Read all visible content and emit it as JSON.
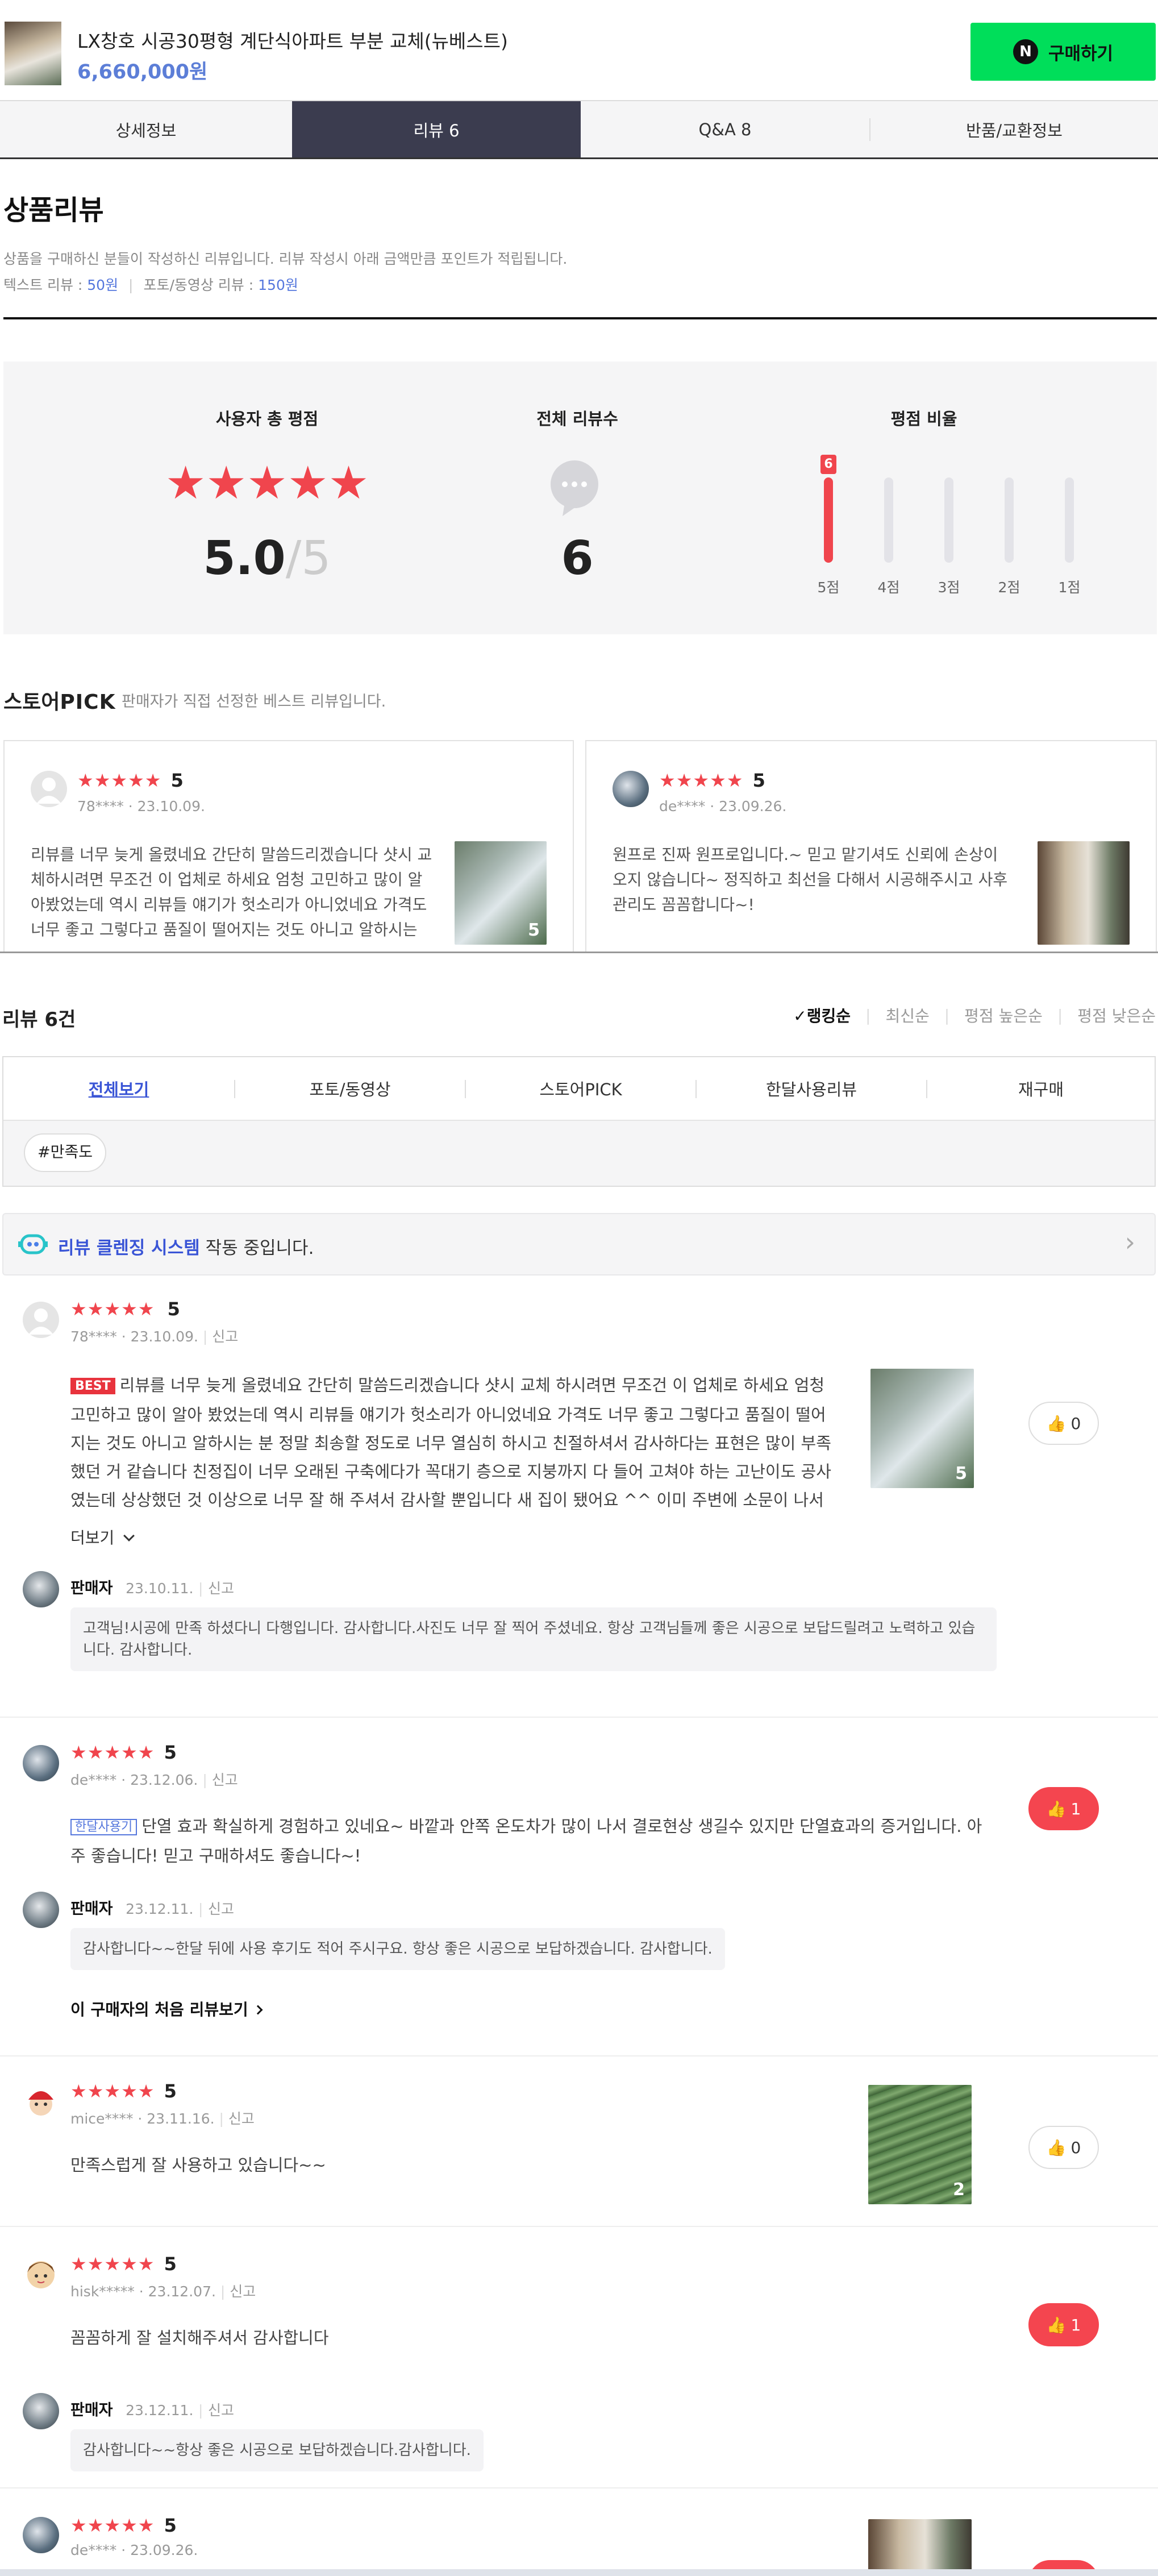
{
  "product": {
    "title": "LX창호 시공30평형 계단식아파트 부분 교체(뉴베스트)",
    "price": "6,660,000원"
  },
  "buy_button": {
    "badge": "N",
    "label": "구매하기"
  },
  "tabs": [
    {
      "label": "상세정보"
    },
    {
      "label": "리뷰 6"
    },
    {
      "label": "Q&A 8"
    },
    {
      "label": "반품/교환정보"
    }
  ],
  "section": {
    "title": "상품리뷰",
    "desc": "상품을 구매하신 분들이 작성하신 리뷰입니다. 리뷰 작성시 아래 금액만큼 포인트가 적립됩니다.",
    "text_review_label": "텍스트 리뷰 :",
    "text_review_points": "50원",
    "photo_review_label": "포토/동영상 리뷰 :",
    "photo_review_points": "150원"
  },
  "summary": {
    "score_title": "사용자 총 평점",
    "stars": "★★★★★",
    "score": "5.0",
    "score_max": "/5",
    "count_title": "전체 리뷰수",
    "count": "6",
    "ratio_title": "평점 비율",
    "bars": [
      {
        "label": "5점",
        "ratio": 1.0,
        "badge": "6"
      },
      {
        "label": "4점",
        "ratio": 0
      },
      {
        "label": "3점",
        "ratio": 0
      },
      {
        "label": "2점",
        "ratio": 0
      },
      {
        "label": "1점",
        "ratio": 0
      }
    ]
  },
  "store_pick": {
    "title_a": "스토어",
    "title_b": "PICK",
    "desc": "판매자가 직접 선정한 베스트 리뷰입니다.",
    "cards": [
      {
        "stars": "★★★★★",
        "score": "5",
        "user": "78****",
        "date": "23.10.09.",
        "text": "리뷰를 너무 늦게 올렸네요 간단히 말씀드리겠습니다 샷시 교체하시려면 무조건 이 업체로 하세요 엄청 고민하고 많이 알아봤었는데 역시 리뷰들 얘기가 헛소리가 아니었네요 가격도 너무 좋고 그렇다고 품질이 떨어지는 것도 아니고 알하시는 분 정말...",
        "photo_count": "5"
      },
      {
        "stars": "★★★★★",
        "score": "5",
        "user": "de****",
        "date": "23.09.26.",
        "text": "원프로 진짜 원프로입니다.~ 믿고 맡기셔도 신뢰에 손상이 오지 않습니다~ 정직하고 최선을 다해서 시공해주시고 사후 관리도 꼼꼼합니다~!",
        "photo_count": ""
      }
    ]
  },
  "review_list": {
    "count_label": "리뷰 6건",
    "sorts": [
      "랭킹순",
      "최신순",
      "평점 높은순",
      "평점 낮은순"
    ],
    "check": "✓",
    "filters": [
      "전체보기",
      "포토/동영상",
      "스토어PICK",
      "한달사용리뷰",
      "재구매"
    ],
    "tag": "#만족도",
    "clean_highlight": "리뷰 클렌징 시스템",
    "clean_rest": " 작동 중입니다.",
    "chevron": "›"
  },
  "reviews": [
    {
      "stars": "★★★★★",
      "score": "5",
      "user": "78****",
      "date": "23.10.09.",
      "report": "신고",
      "badge": "BEST",
      "text": "리뷰를 너무 늦게 올렸네요 간단히 말씀드리겠습니다 샷시 교체 하시려면 무조건 이 업체로 하세요 엄청 고민하고 많이 알아 봤었는데 역시 리뷰들 얘기가 헛소리가 아니었네요 가격도 너무 좋고 그렇다고 품질이 떨어지는 것도 아니고 알하시는 분 정말 최송할 정도로 너무 열심히 하시고 친절하셔서 감사하다는 표현은 많이 부족했던 거 같습니다 친정집이 너무 오래된 구축에다가 꼭대기 층으로 지붕까지 다 들어 고쳐야 하는 고난이도 공사였는데 상상했던 것 이상으로 너무 잘 해 주셔서 감사할 뿐입니다 새 집이 됐어요 ^^ 이미 주변에 소문이 나서 어디서 했냐고 난리입니다 사진을 이것밖에 못 찍어서 ...",
      "more": "더보기",
      "photo_count": "5",
      "likes": "0",
      "seller": {
        "name": "판매자",
        "date": "23.10.11.",
        "report": "신고",
        "text": "고객님!시공에 만족 하셨다니 다행입니다. 감사합니다.사진도 너무 잘 찍어 주셨네요. 항상 고객님들께 좋은 시공으로 보답드릴려고 노력하고 있습니다. 감사합니다."
      }
    },
    {
      "stars": "★★★★★",
      "score": "5",
      "user": "de****",
      "date": "23.12.06.",
      "report": "신고",
      "badge": "한달사용기",
      "text": "단열 효과 확실하게 경험하고 있네요~ 바깥과 안쪽 온도차가 많이 나서 결로현상 생길수 있지만 단열효과의 증거입니다. 아주 좋습니다! 믿고 구매하셔도 좋습니다~!",
      "likes": "1",
      "seller": {
        "name": "판매자",
        "date": "23.12.11.",
        "report": "신고",
        "text": "감사합니다~~한달 뒤에 사용 후기도 적어 주시구요. 항상 좋은 시공으로 보답하겠습니다. 감사합니다."
      },
      "first_review_link": "이 구매자의 처음 리뷰보기"
    },
    {
      "stars": "★★★★★",
      "score": "5",
      "user": "mice****",
      "date": "23.11.16.",
      "report": "신고",
      "text": "만족스럽게 잘 사용하고 있습니다~~",
      "photo_count": "2",
      "likes": "0"
    },
    {
      "stars": "★★★★★",
      "score": "5",
      "user": "hisk*****",
      "date": "23.12.07.",
      "report": "신고",
      "text": "꼼꼼하게 잘 설치해주셔서 감사합니다",
      "likes": "1",
      "seller": {
        "name": "판매자",
        "date": "23.12.11.",
        "report": "신고",
        "text": "감사합니다~~항상 좋은 시공으로 보답하겠습니다.감사합니다."
      }
    },
    {
      "stars": "★★★★★",
      "score": "5",
      "user": "de****",
      "date": "23.09.26."
    }
  ],
  "colors": {
    "accent": "#f0454d",
    "buy": "#00de5a",
    "active_tab": "#3b3c4f",
    "link": "#5577dd"
  }
}
